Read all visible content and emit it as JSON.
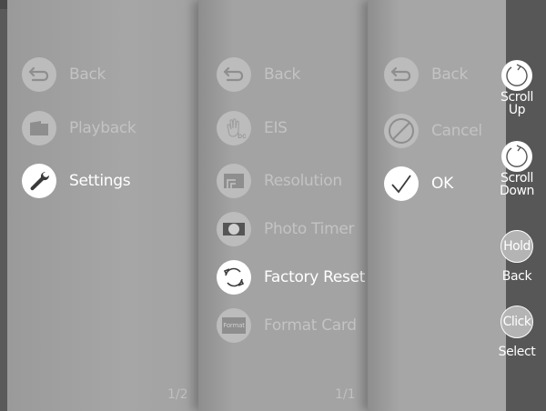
{
  "menus": [
    {
      "page": "1/2",
      "items": [
        {
          "label": "Back",
          "icon": "back-arrow-icon",
          "state": "dim"
        },
        {
          "label": "Playback",
          "icon": "folder-icon",
          "state": "dim"
        },
        {
          "label": "Settings",
          "icon": "wrench-icon",
          "state": "active"
        }
      ]
    },
    {
      "page": "1/1",
      "items": [
        {
          "label": "Back",
          "icon": "back-arrow-icon",
          "state": "dim"
        },
        {
          "label": "EIS",
          "icon": "hand-shake-icon",
          "state": "dim"
        },
        {
          "label": "Resolution",
          "icon": "resolution-icon",
          "state": "dim"
        },
        {
          "label": "Photo Timer",
          "icon": "photo-timer-icon",
          "state": "dim"
        },
        {
          "label": "Factory Reset",
          "icon": "reset-arrows-icon",
          "state": "active"
        },
        {
          "label": "Format Card",
          "icon": "format-card-icon",
          "state": "dim",
          "icon_text": "Format"
        }
      ]
    },
    {
      "items": [
        {
          "label": "Back",
          "icon": "back-arrow-icon",
          "state": "dim"
        },
        {
          "label": "Cancel",
          "icon": "cancel-icon",
          "state": "dim"
        },
        {
          "label": "OK",
          "icon": "checkmark-icon",
          "state": "active"
        }
      ]
    }
  ],
  "sidebar": {
    "scroll_up": {
      "line1": "Scroll",
      "line2": "Up"
    },
    "scroll_down": {
      "line1": "Scroll",
      "line2": "Down"
    },
    "hold": {
      "circle": "Hold",
      "label": "Back"
    },
    "click": {
      "circle": "Click",
      "label": "Select"
    }
  },
  "colors": {
    "pane_bg": "#a3a3a3",
    "sidebar_bg": "#575757",
    "dim_text": "#c3c3c3",
    "active_text": "#ffffff"
  }
}
